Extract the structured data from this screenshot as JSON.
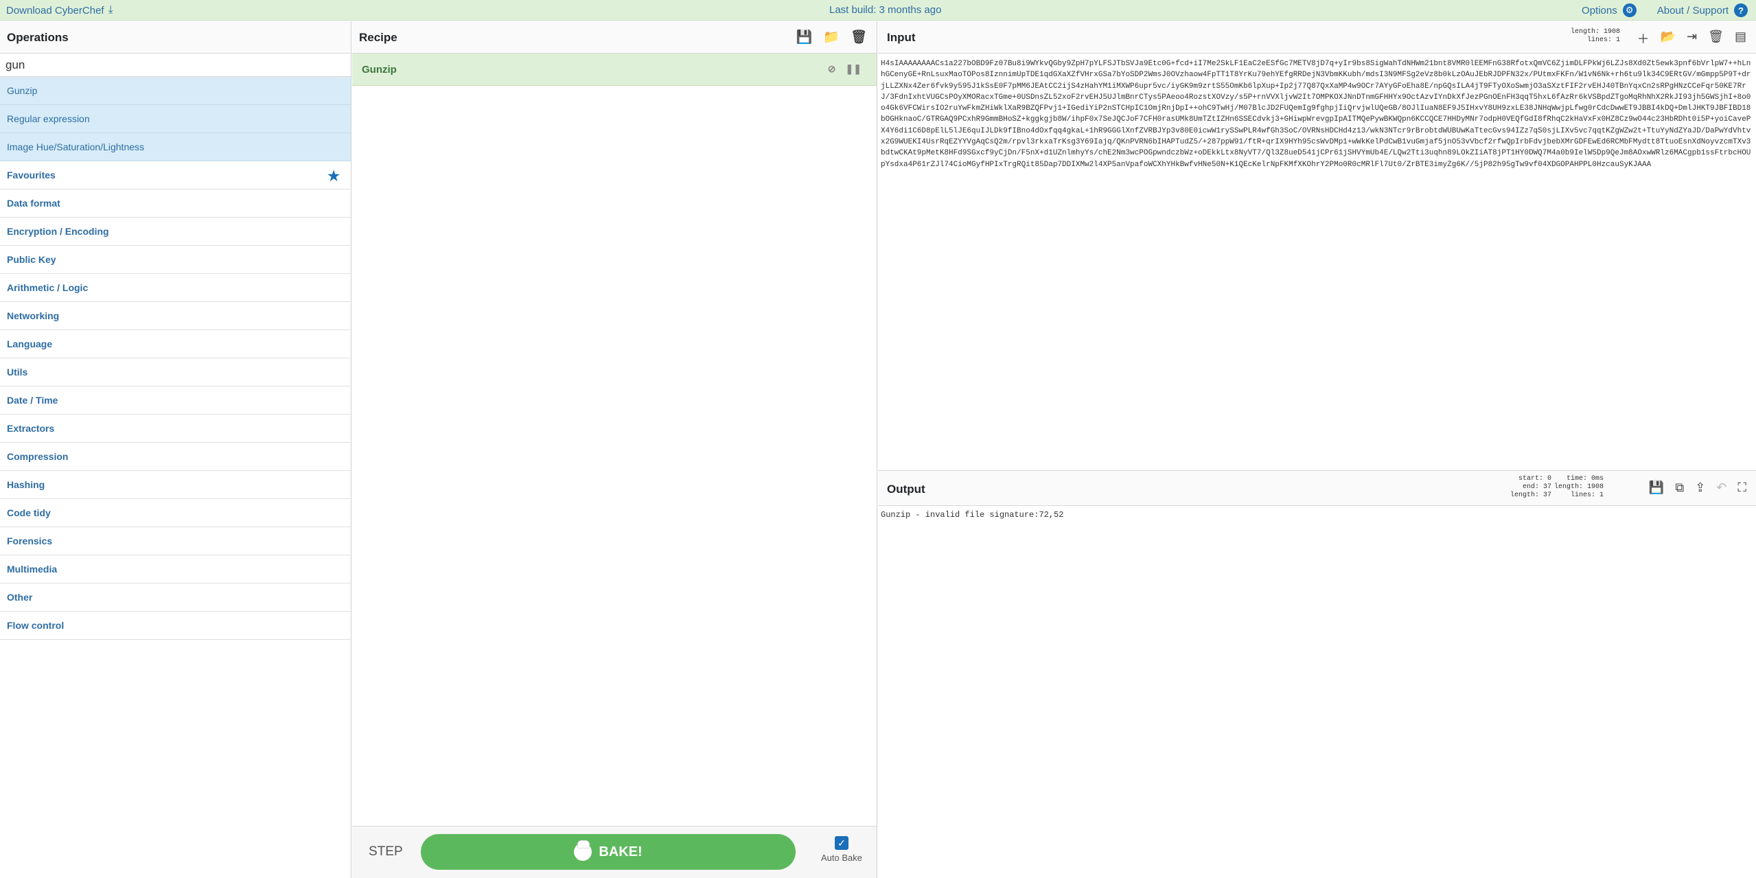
{
  "banner": {
    "download_label": "Download CyberChef",
    "build_text": "Last build: 3 months ago",
    "options_label": "Options",
    "about_label": "About / Support"
  },
  "operations": {
    "title": "Operations",
    "search_value": "gun",
    "results": [
      "Gunzip",
      "Regular expression",
      "Image Hue/Saturation/Lightness"
    ],
    "categories": [
      "Favourites",
      "Data format",
      "Encryption / Encoding",
      "Public Key",
      "Arithmetic / Logic",
      "Networking",
      "Language",
      "Utils",
      "Date / Time",
      "Extractors",
      "Compression",
      "Hashing",
      "Code tidy",
      "Forensics",
      "Multimedia",
      "Other",
      "Flow control"
    ]
  },
  "recipe": {
    "title": "Recipe",
    "items": [
      "Gunzip"
    ],
    "step_label": "STEP",
    "bake_label": "BAKE!",
    "auto_bake_label": "Auto Bake"
  },
  "input": {
    "title": "Input",
    "length_label": "length: 1908",
    "lines_label": "lines: 1",
    "text": "H4sIAAAAAAAACs1a227bOBD9Fz07Bu8i9WYkvQGby9ZpH7pYLFSJTbSVJa9Etc0G+fcd+iI7Me2SkLF1EaC2eESfGc7METV8jD7q+yIr9bs8SigWahTdNHWm21bnt8VMR0lEEMFnG38RfotxQmVC6ZjimDLFPkWj6LZJs8Xd0Zt5ewk3pnf6bVrlpW7++hLnhGCenyGE+RnLsuxMaoTOPos8IznnimUpTDE1qdGXaXZfVHrxGSa7bYoSDP2WmsJ0OVzhaow4FpTT1T8YrKu79ehYEfgRRDejN3VbmKKubh/mdsI3N9MFSg2eVz8b0kLzOAuJEbRJDPFN32x/PUtmxFKFn/W1vN6Nk+rh6tu9lk34C9ERtGV/mGmpp5P9T+drjLLZXNx4Zer6fvk9y595J1kSsE0F7pMM6JEAtCC2ijS4zHahYM1iMXWP6upr5vc/iyGK9m9zrtS55OmKb6lpXup+Ip2j77Q87QxXaMP4w9OCr7AYyGFoEha8E/npGQsILA4jT9FTyOXoSwmjO3aSXztFIF2rvEHJ40TBnYqxCn2sRPgHNzCCeFqr50KE7RrJ/3FdnIxhtVUGCsPOyXMORacxTGme+0USDnsZL52xoF2rvEHJ5UJlmBnrCTys5PAeoo4RozstXOVzy/s5P+rnVVXljvW2It7OMPKOXJNnDTnmGFHHYx9OctAzvIYnDkXfJezPGnOEnFH3qqT5hxL6fAzRr6kVSBpdZTgoMqRhNhX2RkJI93jh5GWSjhI+8o0o4Gk6VFCWirsIO2ruYwFkmZHiWklXaR9BZQFPvj1+IGediYiP2nSTCHpIC1OmjRnjDpI++ohC9TwHj/M07BlcJD2FUQemIg9fghpjIiQrvjwlUQeGB/8OJlIuaN8EF9J5IHxvY8UH9zxLE38JNHqWwjpLfwg0rCdcDwwET9JBBI4kDQ+DmlJHKT9JBFIBD18bOGHknaoC/GTRGAQ9PCxhR9GmmBHoSZ+kggkgjb8W/ihpF0x7SeJQCJoF7CFH0rasUMk8UmTZtIZHn6SSECdvkj3+GHiwpWrevgpIpAITMQePywBKWQpn6KCCQCE7HHDyMNr7odpH0VEQfGdI8fRhqC2kHaVxFx0HZ8Cz9wO44c23HbRDht0i5P+yoiCavePX4Y6di1C6D8pElL5lJE6quIJLDk9fIBno4dOxfqq4gkaL+1hR9GGGlXnfZVRBJYp3v80E0icwW1rySSwPLR4wfGh3SoC/OVRNsHDCHd4z13/wkN3NTcr9rBrobtdWUBUwKaTtecGvs94IZz7qS0sjLIXv5vc7qqtKZgWZw2t+TtuYyNdZYaJD/DaPwYdVhtvx2G9WUEKI4UsrRqEZYYVgAqCsQ2m/rpvl3rkxaTrKsg3Y69Iajq/QKnPVRN6bIHAPTudZ5/+287ppW91/ftR+qrIX9HYh95csWvDMp1+wWkKelPdCwB1vuGmjaf5jnO53vVbcf2rfwQpIrbFdvjbebXMrGDFEwEd6RCMbFMydtt8TtuoEsnXdNoyvzcmTXv3bdtwCKAt9pMetK8HFd9SGxcf9yCjDn/F5nX+d1UZnlmhyYs/chE2Nm3wcPOGpwndczbWz+oDEkkLtx8NyVT7/Ql3Z8ueD541jCPr61jSHVYmUb4E/LQw2Tti3uqhn89LOkZIiAT8jPT1HY0DWQ7M4a0b9IelW5Dp9QeJm8AOxwWRlz6MACgpb1ssFtrbcHOUpYsdxa4P61rZJl74CioMGyfHPIxTrgRQit85Dap7DDIXMw2l4XP5anVpafoWCXhYHkBwfvHNe50N+K1QEcKelrNpFKMfXKOhrY2PMo0R0cMRlFl7Ut0/ZrBTE3imyZg6K//5jP82h95gTw9vf04XDGOPAHPPL0HzcauSyKJAAA"
  },
  "output": {
    "title": "Output",
    "start_label": "start: 0",
    "end_label": "end: 37",
    "length_label": "length: 37",
    "time_label": "time: 0ms",
    "olength_label": "length: 1908",
    "lines_label": "lines: 1",
    "text": "Gunzip - invalid file signature:72,52"
  }
}
